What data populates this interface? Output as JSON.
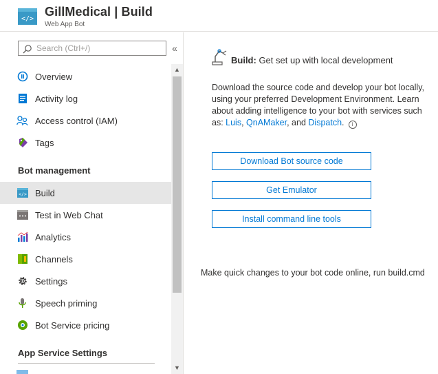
{
  "header": {
    "title": "GillMedical | Build",
    "subtitle": "Web App Bot"
  },
  "search": {
    "placeholder": "Search (Ctrl+/)"
  },
  "sidebar": {
    "top_items": [
      {
        "label": "Overview",
        "icon": "overview-icon"
      },
      {
        "label": "Activity log",
        "icon": "activity-log-icon"
      },
      {
        "label": "Access control (IAM)",
        "icon": "people-icon"
      },
      {
        "label": "Tags",
        "icon": "tag-icon"
      }
    ],
    "bot_management_title": "Bot management",
    "bot_items": [
      {
        "label": "Build",
        "icon": "code-icon",
        "selected": true
      },
      {
        "label": "Test in Web Chat",
        "icon": "chat-icon"
      },
      {
        "label": "Analytics",
        "icon": "analytics-icon"
      },
      {
        "label": "Channels",
        "icon": "channels-icon"
      },
      {
        "label": "Settings",
        "icon": "gear-icon"
      },
      {
        "label": "Speech priming",
        "icon": "speech-icon"
      },
      {
        "label": "Bot Service pricing",
        "icon": "pricing-icon"
      }
    ],
    "app_service_title": "App Service Settings"
  },
  "main": {
    "heading_bold": "Build:",
    "heading_rest": " Get set up with local development",
    "description_text": "Download the source code and develop your bot locally, using your preferred Development Environment. Learn about adding intelligence to your bot with services such as: ",
    "link_luis": "Luis",
    "sep1": ", ",
    "link_qnamaker": "QnAMaker",
    "sep2": ", and",
    "link_dispatch": "Dispatch",
    "sep3": ".",
    "buttons": {
      "download": "Download Bot source code",
      "emulator": "Get Emulator",
      "cli": "Install command line tools"
    },
    "quick_changes": "Make quick changes to your bot code online, run build.cmd"
  },
  "colors": {
    "accent": "#0078d4",
    "selected_bg": "#e6e6e6"
  }
}
